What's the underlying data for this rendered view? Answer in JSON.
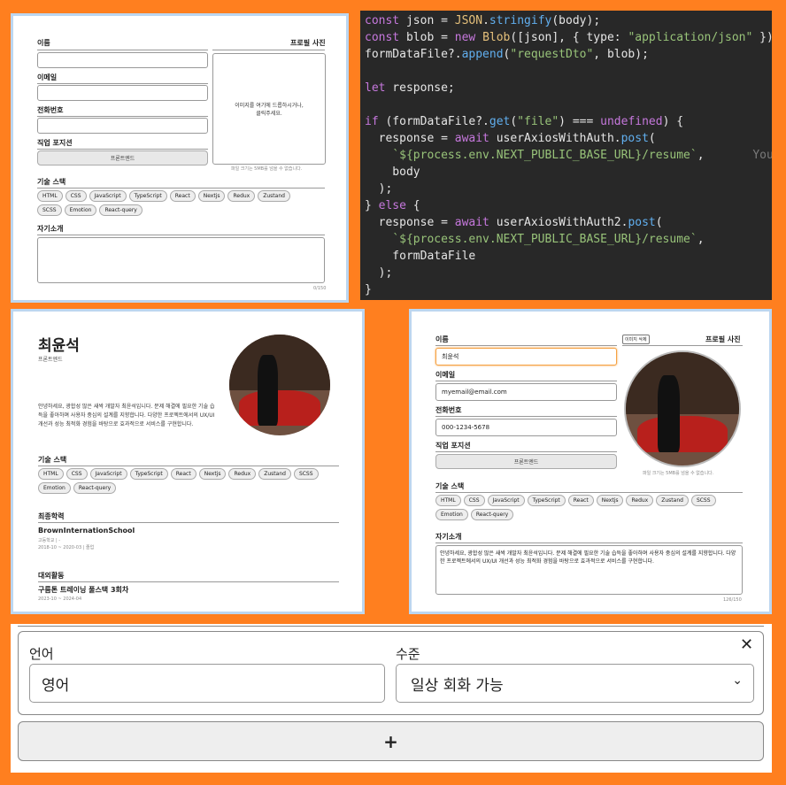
{
  "form_empty": {
    "name_label": "이름",
    "email_label": "이메일",
    "phone_label": "전화번호",
    "position_label": "직업 포지션",
    "position_value": "프론트엔드",
    "photo_label": "프로필 사진",
    "photo_drop_hint": "이미지를 여기에 드롭하시거나,\n클릭주세요.",
    "photo_limit": "파일 크기는 5MB를 넘을 수 없습니다.",
    "skills_label": "기술 스택",
    "skills": [
      "HTML",
      "CSS",
      "JavaScript",
      "TypeScript",
      "React",
      "Nextjs",
      "Redux",
      "Zustand",
      "SCSS",
      "Emotion",
      "React-query"
    ],
    "intro_label": "자기소개",
    "intro_count": "0/150"
  },
  "code": {
    "lines": [
      "const json = JSON.stringify(body);",
      "const blob = new Blob([json], { type: \"application/json\" });",
      "formDataFile?.append(\"requestDto\", blob);",
      "",
      "let response;",
      "",
      "if (formDataFile?.get(\"file\") === undefined) {",
      "  response = await userAxiosWithAuth.post(",
      "    `${process.env.NEXT_PUBLIC_BASE_URL}/resume`,",
      "    body",
      "  );",
      "} else {",
      "  response = await userAxiosWithAuth2.post(",
      "    `${process.env.NEXT_PUBLIC_BASE_URL}/resume`,",
      "    formDataFile",
      "  );",
      "}"
    ],
    "blame_hint": "You, :"
  },
  "resume": {
    "name": "최윤석",
    "position": "프론트엔드",
    "intro": "안녕하세요, 광합성 많은 새싹 개발자 최윤석입니다. 문제 해결에 필요한 기술 습득을 좋아하며 사용자 중심의 설계를 지향합니다. 다양한 프로젝트에서의 UX/UI 개선과 성능 최적화 경험을 바탕으로 효과적으로 서비스를 구현합니다.",
    "skills_label": "기술 스택",
    "skills": [
      "HTML",
      "CSS",
      "JavaScript",
      "TypeScript",
      "React",
      "Nextjs",
      "Redux",
      "Zustand",
      "SCSS",
      "Emotion",
      "React-query"
    ],
    "edu_label": "최종학력",
    "school": "BrownInternationSchool",
    "school_type": "고등학교 | -",
    "school_period": "2018-10 ~ 2020-03 | 졸업",
    "activity_label": "대외활동",
    "activity": "구름톤 트레이닝 풀스택 3회차",
    "activity_period": "2023-10 ~ 2024-04"
  },
  "form_filled": {
    "name_label": "이름",
    "name_value": "최윤석",
    "email_label": "이메일",
    "email_value": "myemail@email.com",
    "phone_label": "전화번호",
    "phone_value": "000-1234-5678",
    "position_label": "직업 포지션",
    "position_value": "프론트엔드",
    "photo_label": "프로필 사진",
    "delete_photo": "이미지 삭제",
    "photo_limit": "파일 크기는 5MB를 넘을 수 없습니다.",
    "skills_label": "기술 스택",
    "skills": [
      "HTML",
      "CSS",
      "JavaScript",
      "TypeScript",
      "React",
      "Nextjs",
      "Redux",
      "Zustand",
      "SCSS",
      "Emotion",
      "React-query"
    ],
    "intro_label": "자기소개",
    "intro_value": "안녕하세요, 광합성 많은 새싹 개발자 최윤석입니다. 문제 해결에 필요한 기술 습득을 좋아하며 사용자 중심의 설계를 지향합니다. 다양한 프로젝트에서의 UX/UI 개선과 성능 최적화 경험을 바탕으로 효과적으로 서비스를 구현합니다.",
    "intro_count": "126/150"
  },
  "language": {
    "lang_label": "언어",
    "lang_value": "영어",
    "level_label": "수준",
    "level_value": "일상 회화 가능",
    "close_icon": "close-icon",
    "add_label": "+"
  },
  "colors": {
    "background": "#ff7f1f",
    "code_bg": "#282828",
    "focus": "#f5a142"
  }
}
